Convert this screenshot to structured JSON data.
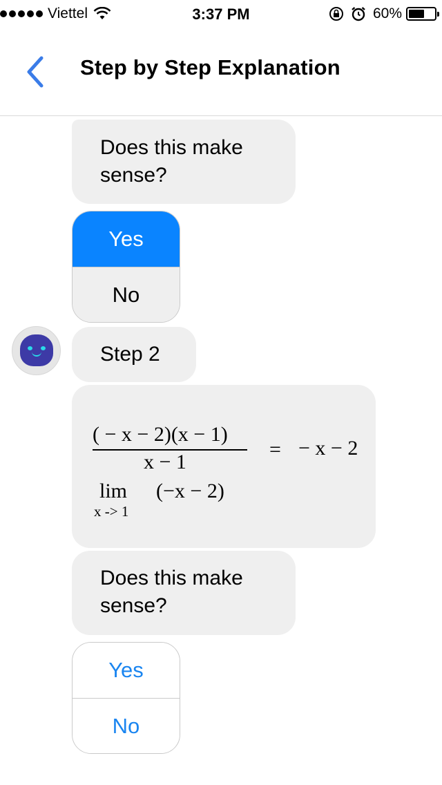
{
  "status_bar": {
    "carrier": "Viettel",
    "time": "3:37 PM",
    "battery_percent": "60%",
    "battery_level": 0.6,
    "icons": [
      "signal-dots-icon",
      "wifi-icon",
      "orientation-lock-icon",
      "alarm-icon",
      "battery-icon"
    ]
  },
  "nav": {
    "back_icon": "chevron-left-icon",
    "title": "Step by Step Explanation"
  },
  "messages": {
    "prompt_1": "Does this make sense?",
    "step_label": "Step 2",
    "math": {
      "numerator": "( − x − 2)(x − 1)",
      "denominator": "x − 1",
      "equals": "=",
      "result": "− x − 2",
      "lim_word": "lim",
      "lim_expr": "(−x − 2)",
      "lim_sub": "x -> 1"
    },
    "prompt_2": "Does this make sense?"
  },
  "choices_1": {
    "yes": "Yes",
    "no": "No",
    "selected": "Yes"
  },
  "choices_2": {
    "yes": "Yes",
    "no": "No"
  },
  "colors": {
    "accent": "#0a84ff",
    "link": "#1a85f0",
    "bubble": "#efefef",
    "avatar_face": "#3d3aa6",
    "avatar_eyes": "#2ad9e8"
  }
}
